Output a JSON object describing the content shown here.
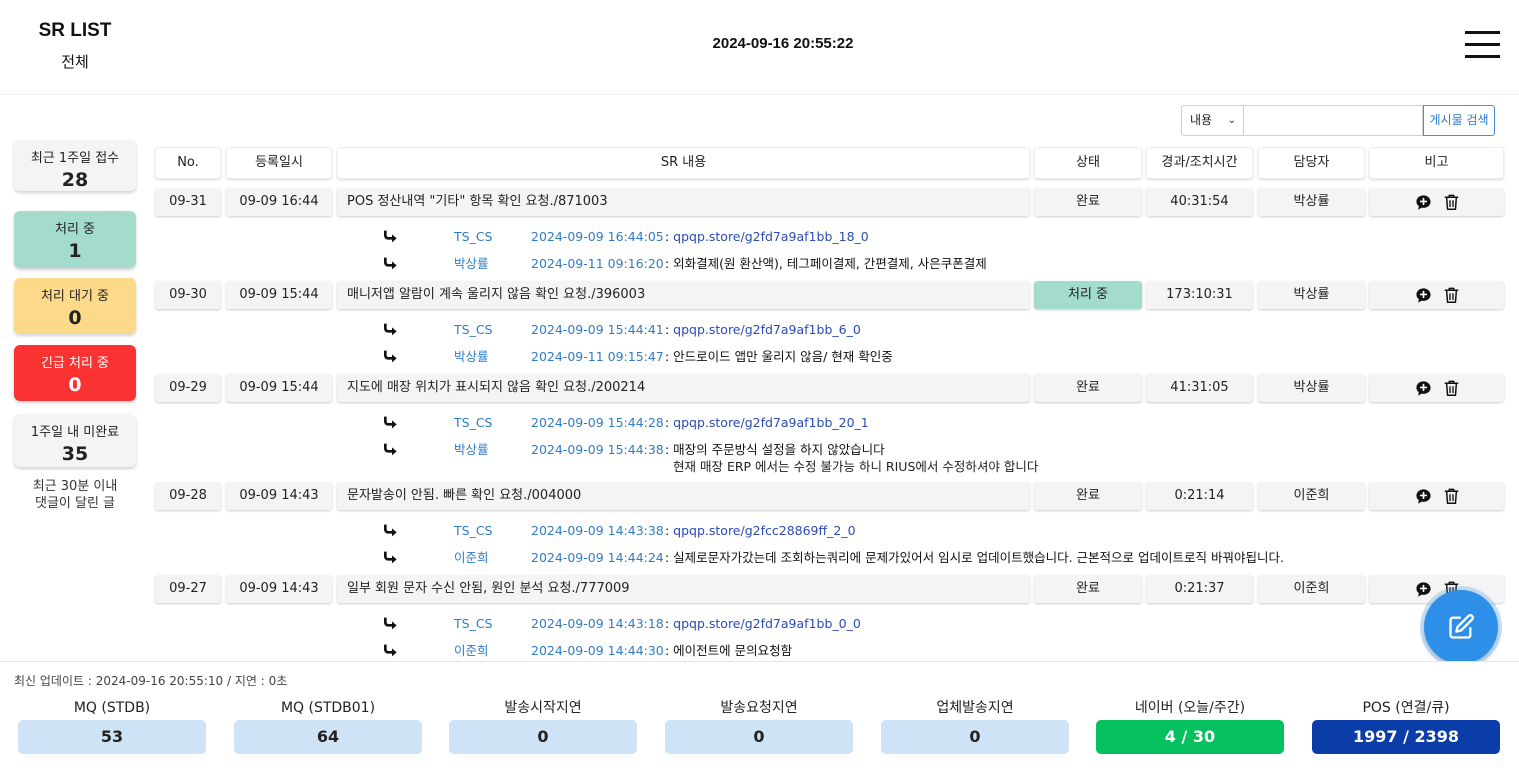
{
  "header": {
    "title": "SR LIST",
    "subtitle": "전체",
    "datetime": "2024-09-16 20:55:22"
  },
  "sidebar": {
    "cards": [
      {
        "label": "최근 1주일 접수",
        "count": "28",
        "color": "#f4f4f4",
        "text_color": "#222222"
      },
      {
        "label": "처리 중",
        "count": "1",
        "color": "#a3dccd",
        "text_color": "#222222"
      },
      {
        "label": "처리 대기 중",
        "count": "0",
        "color": "#fdd98a",
        "text_color": "#222222"
      },
      {
        "label": "긴급 처리 중",
        "count": "0",
        "color": "#fb3232",
        "text_color": "#ffffff"
      },
      {
        "label": "1주일 내 미완료",
        "count": "35",
        "color": "#f4f4f4",
        "text_color": "#222222"
      }
    ],
    "note_line1": "최근 30분 이내",
    "note_line2": "댓글이 달린 글"
  },
  "search": {
    "select_value": "내용",
    "input_value": "",
    "button_label": "게시물 검색"
  },
  "table": {
    "headers": [
      "No.",
      "등록일시",
      "SR 내용",
      "상태",
      "경과/조치시간",
      "담당자",
      "비고"
    ],
    "rows": [
      {
        "no": "09-31",
        "date": "09-09 16:44",
        "content": "POS 정산내역 \"기타\" 항목 확인 요청./871003",
        "status": "완료",
        "elapsed": "40:31:54",
        "owner": "박상률",
        "comments": [
          {
            "author": "TS_CS",
            "time": "2024-09-09 16:44:05",
            "sep": " : ",
            "text": "qpqp.store/g2fd7a9af1bb_18_0",
            "link": true
          },
          {
            "author": "박상률",
            "time": "2024-09-11 09:16:20",
            "sep": " : ",
            "text": "외화결제(원 환산액), 테그페이결제, 간편결제, 사은쿠폰결제",
            "link": false
          }
        ]
      },
      {
        "no": "09-30",
        "date": "09-09 15:44",
        "content": "매니저앱 알람이 계속 울리지 않음 확인 요청./396003",
        "status": "처리 중",
        "elapsed": "173:10:31",
        "owner": "박상률",
        "comments": [
          {
            "author": "TS_CS",
            "time": "2024-09-09 15:44:41",
            "sep": " : ",
            "text": "qpqp.store/g2fd7a9af1bb_6_0",
            "link": true
          },
          {
            "author": "박상률",
            "time": "2024-09-11 09:15:47",
            "sep": " : ",
            "text": "안드로이드 앱만 울리지 않음/ 현재 확인중",
            "link": false
          }
        ]
      },
      {
        "no": "09-29",
        "date": "09-09 15:44",
        "content": "지도에 매장 위치가 표시되지 않음 확인 요청./200214",
        "status": "완료",
        "elapsed": "41:31:05",
        "owner": "박상률",
        "comments": [
          {
            "author": "TS_CS",
            "time": "2024-09-09 15:44:28",
            "sep": " : ",
            "text": "qpqp.store/g2fd7a9af1bb_20_1",
            "link": true
          },
          {
            "author": "박상률",
            "time": "2024-09-09 15:44:38",
            "sep": " : ",
            "text": "매장의 주문방식 설정을 하지 않았습니다",
            "text2": "현재 매장 ERP 에서는 수정 불가능 하니 RIUS에서 수정하셔야 합니다",
            "link": false
          }
        ]
      },
      {
        "no": "09-28",
        "date": "09-09 14:43",
        "content": "문자발송이 안됨. 빠른 확인 요청./004000",
        "status": "완료",
        "elapsed": "0:21:14",
        "owner": "이준희",
        "comments": [
          {
            "author": "TS_CS",
            "time": "2024-09-09 14:43:38",
            "sep": " : ",
            "text": "qpqp.store/g2fcc28869ff_2_0",
            "link": true
          },
          {
            "author": "이준희",
            "time": "2024-09-09 14:44:24",
            "sep": " : ",
            "text": "실제로문자가갔는데 조회하는쿼리에 문제가있어서 임시로 업데이트했습니다. 근본적으로 업데이트로직 바꿔야됩니다.",
            "link": false
          }
        ]
      },
      {
        "no": "09-27",
        "date": "09-09 14:43",
        "content": "일부 회원 문자 수신 안됨, 원인 분석 요청./777009",
        "status": "완료",
        "elapsed": "0:21:37",
        "owner": "이준희",
        "comments": [
          {
            "author": "TS_CS",
            "time": "2024-09-09 14:43:18",
            "sep": " : ",
            "text": "qpqp.store/g2fd7a9af1bb_0_0",
            "link": true
          },
          {
            "author": "이준희",
            "time": "2024-09-09 14:44:30",
            "sep": " : ",
            "text": "에이전트에 문의요청함",
            "link": false
          }
        ]
      }
    ]
  },
  "footer": {
    "update_text": "최신 업데이트 : 2024-09-16 20:55:10  /  지연 : 0초",
    "metrics": [
      {
        "label": "MQ (STDB)",
        "value": "53",
        "style": "default"
      },
      {
        "label": "MQ (STDB01)",
        "value": "64",
        "style": "default"
      },
      {
        "label": "발송시작지연",
        "value": "0",
        "style": "default"
      },
      {
        "label": "발송요청지연",
        "value": "0",
        "style": "default"
      },
      {
        "label": "업체발송지연",
        "value": "0",
        "style": "default"
      },
      {
        "label": "네이버 (오늘/주간)",
        "value": "4 / 30",
        "style": "green"
      },
      {
        "label": "POS (연결/큐)",
        "value": "1997 / 2398",
        "style": "navy"
      }
    ]
  },
  "icons": {
    "comment": "comment-plus-icon",
    "delete": "trash-icon",
    "reply": "reply-arrow-icon",
    "write": "edit-icon",
    "menu": "hamburger-menu-icon"
  },
  "colors": {
    "processing": "#a3dccd",
    "waiting": "#fdd98a",
    "urgent": "#fb3232",
    "link": "#2f7cc8",
    "fab": "#2e8fe8",
    "naver": "#05c05f",
    "pos": "#0a3da8",
    "metric": "#cfe3f6"
  }
}
